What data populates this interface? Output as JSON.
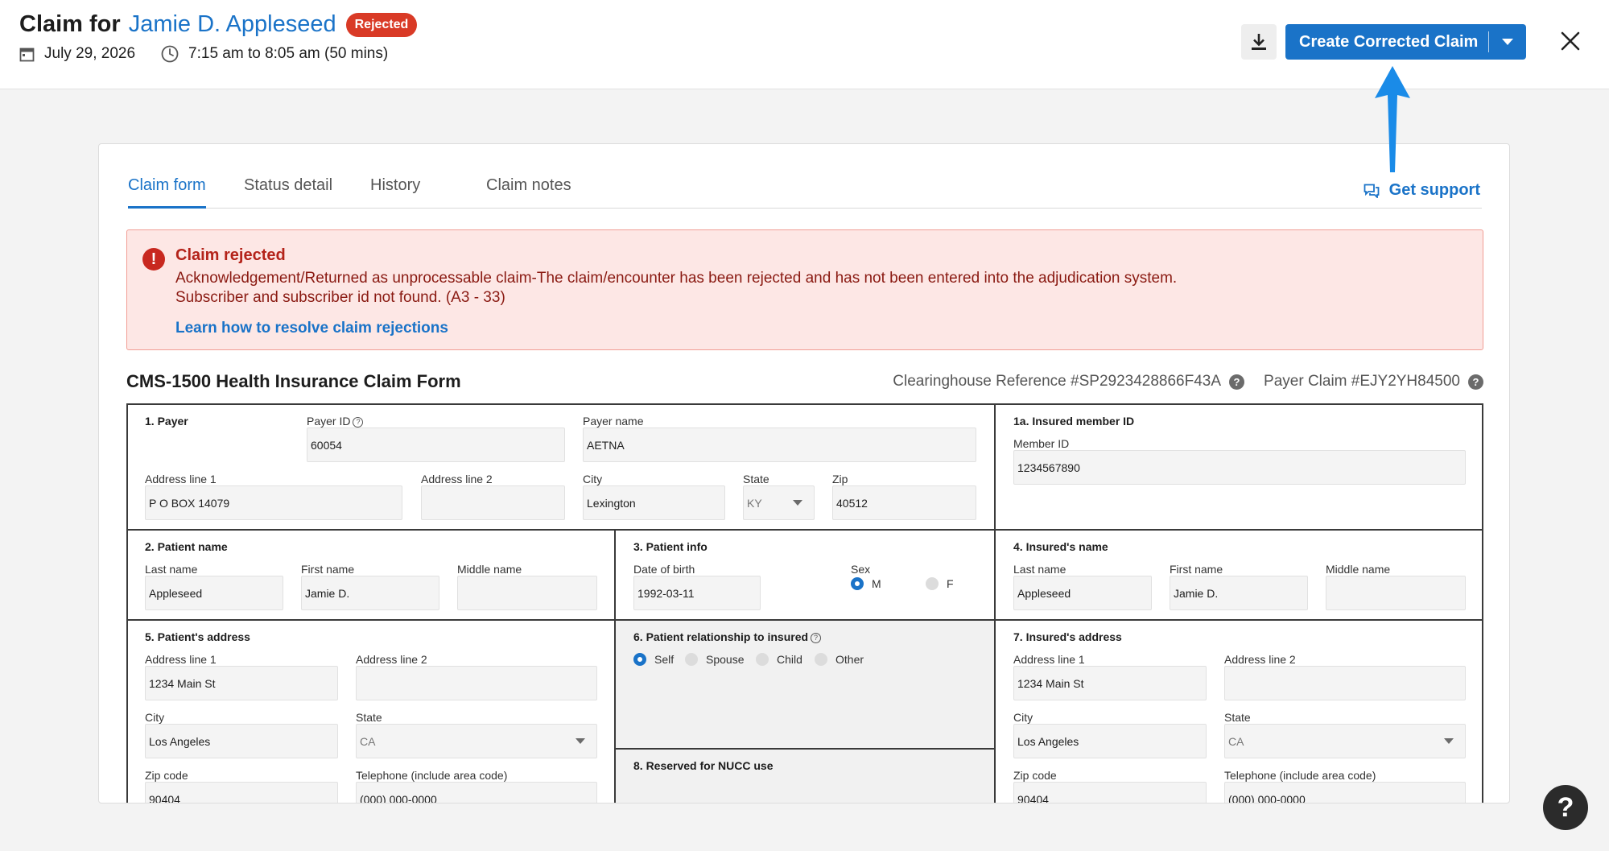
{
  "header": {
    "title_prefix": "Claim for",
    "patient_name": "Jamie D. Appleseed",
    "status_badge": "Rejected",
    "date": "July 29, 2026",
    "time_range": "7:15 am to 8:05 am (50 mins)",
    "primary_action": "Create Corrected Claim"
  },
  "tabs": [
    "Claim form",
    "Status detail",
    "History",
    "Claim notes"
  ],
  "support_label": "Get support",
  "alert": {
    "title": "Claim rejected",
    "line1": "Acknowledgement/Returned as unprocessable claim-The claim/encounter has been rejected and has not been entered into the adjudication system.",
    "line2": "Subscriber and subscriber id not found. (A3 - 33)",
    "link": "Learn how to resolve claim rejections"
  },
  "form": {
    "title": "CMS-1500 Health Insurance Claim Form",
    "clearinghouse_ref": "Clearinghouse Reference #SP2923428866F43A",
    "payer_claim": "Payer Claim #EJY2YH84500",
    "payer": {
      "section": "1. Payer",
      "payer_id_label": "Payer ID",
      "payer_id": "60054",
      "payer_name_label": "Payer name",
      "payer_name": "AETNA",
      "address1_label": "Address line 1",
      "address1": "P O BOX 14079",
      "address2_label": "Address line 2",
      "address2": "",
      "city_label": "City",
      "city": "Lexington",
      "state_label": "State",
      "state": "KY",
      "zip_label": "Zip",
      "zip": "40512"
    },
    "insured_member": {
      "section": "1a. Insured member ID",
      "member_id_label": "Member ID",
      "member_id": "1234567890"
    },
    "patient_name": {
      "section": "2. Patient name",
      "last_label": "Last name",
      "last": "Appleseed",
      "first_label": "First name",
      "first": "Jamie D.",
      "middle_label": "Middle name",
      "middle": ""
    },
    "patient_info": {
      "section": "3. Patient info",
      "dob_label": "Date of birth",
      "dob": "1992-03-11",
      "sex_label": "Sex",
      "sex_m": "M",
      "sex_f": "F"
    },
    "insured_name": {
      "section": "4. Insured's name",
      "last_label": "Last name",
      "last": "Appleseed",
      "first_label": "First name",
      "first": "Jamie D.",
      "middle_label": "Middle name",
      "middle": ""
    },
    "patient_address": {
      "section": "5. Patient's address",
      "address1_label": "Address line 1",
      "address1": "1234 Main St",
      "address2_label": "Address line 2",
      "address2": "",
      "city_label": "City",
      "city": "Los Angeles",
      "state_label": "State",
      "state": "CA",
      "zip_label": "Zip code",
      "zip": "90404",
      "phone_label": "Telephone (include area code)",
      "phone": "(000) 000-0000"
    },
    "relationship": {
      "section": "6. Patient relationship to insured",
      "options": [
        "Self",
        "Spouse",
        "Child",
        "Other"
      ]
    },
    "nucc": {
      "section": "8. Reserved for NUCC use"
    },
    "insured_address": {
      "section": "7. Insured's address",
      "address1_label": "Address line 1",
      "address1": "1234 Main St",
      "address2_label": "Address line 2",
      "address2": "",
      "city_label": "City",
      "city": "Los Angeles",
      "state_label": "State",
      "state": "CA",
      "zip_label": "Zip code",
      "zip": "90404",
      "phone_label": "Telephone (include area code)",
      "phone": "(000) 000-0000"
    }
  },
  "help_fab": "?",
  "colors": {
    "accent": "#1a73c8",
    "danger": "#d93a26"
  },
  "icons": [
    "calendar-icon",
    "clock-icon",
    "download-icon",
    "chevron-down-icon",
    "close-icon",
    "chat-icon",
    "alert-icon",
    "help-icon"
  ]
}
